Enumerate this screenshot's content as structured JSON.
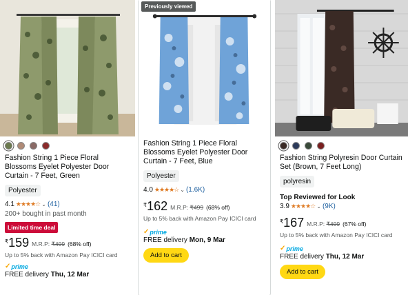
{
  "products": [
    {
      "title": "Fashion String 1 Piece Floral Blossoms Eyelet Polyester Door Curtain - 7 Feet, Green",
      "swatches": [
        "#6b7a4f",
        "#b08b77",
        "#8a6a66",
        "#8a2a2a"
      ],
      "material": "Polyester",
      "rating": "4.1",
      "stars": "★★★★☆",
      "review_count": "(41)",
      "bought": "200+ bought in past month",
      "deal": "Limited time deal",
      "currency": "₹",
      "price": "159",
      "mrp_label": "M.R.P:",
      "mrp": "₹499",
      "discount": "(68% off)",
      "cashback": "Up to 5% back with Amazon Pay ICICI card",
      "prime": "prime",
      "delivery_prefix": "FREE delivery",
      "delivery_date": "Thu, 12 Mar"
    },
    {
      "badge": "Previously viewed",
      "title": "Fashion String 1 Piece Floral Blossoms Eyelet Polyester Door Curtain - 7 Feet, Blue",
      "material": "Polyester",
      "rating": "4.0",
      "stars": "★★★★☆",
      "review_count": "(1.6K)",
      "currency": "₹",
      "price": "162",
      "mrp_label": "M.R.P:",
      "mrp": "₹499",
      "discount": "(68% off)",
      "cashback": "Up to 5% back with Amazon Pay ICICI card",
      "prime": "prime",
      "delivery_prefix": "FREE delivery",
      "delivery_date": "Mon, 9 Mar",
      "add_to_cart": "Add to cart"
    },
    {
      "title": "Fashion String Polyresin Door Curtain Set (Brown, 7 Feet Long)",
      "swatches": [
        "#3a2a25",
        "#2c3a5a",
        "#3a4a3a",
        "#7a1f1f"
      ],
      "material": "polyresin",
      "top_reviewed": "Top Reviewed for Look",
      "rating": "3.9",
      "stars": "★★★★☆",
      "review_count": "(9K)",
      "currency": "₹",
      "price": "167",
      "mrp_label": "M.R.P:",
      "mrp": "₹499",
      "discount": "(67% off)",
      "cashback": "Up to 5% back with Amazon Pay ICICI card",
      "prime": "prime",
      "delivery_prefix": "FREE delivery",
      "delivery_date": "Thu, 12 Mar",
      "add_to_cart": "Add to cart"
    }
  ]
}
